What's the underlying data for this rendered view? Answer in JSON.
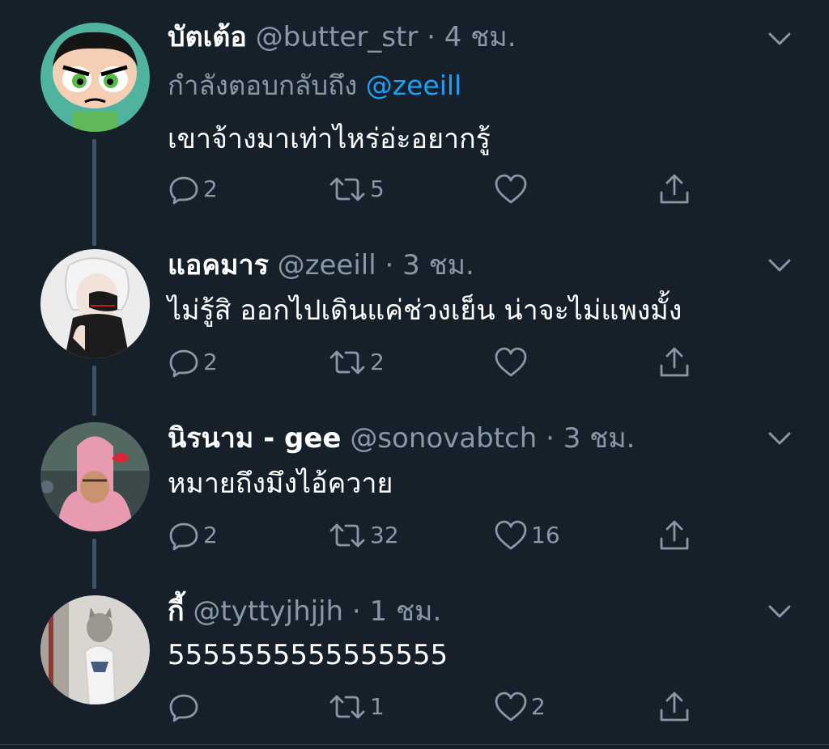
{
  "colors": {
    "background": "#15202b",
    "secondary_text": "#8899a6",
    "link": "#1da1f2",
    "thread_line": "#3d5466"
  },
  "tweets": [
    {
      "display_name": "บัตเต้อ",
      "handle": "@butter_str",
      "separator": "·",
      "time": "4 ชม.",
      "reply_prefix": "กำลังตอบกลับถึง",
      "reply_mention": "@zeeill",
      "text": "เขาจ้างมาเท่าไหร่อ่ะอยากรู้",
      "reply_count": "2",
      "retweet_count": "5",
      "like_count": "",
      "avatar_icon": "powerpuff-buttercup-avatar"
    },
    {
      "display_name": "แอคมาร",
      "handle": "@zeeill",
      "separator": "·",
      "time": "3 ชม.",
      "text": "ไม่รู้สิ ออกไปเดินแค่ช่วงเย็น น่าจะไม่แพงมั้ง",
      "reply_count": "2",
      "retweet_count": "2",
      "like_count": "",
      "avatar_icon": "anime-masked-character-avatar"
    },
    {
      "display_name": "นิรนาม - gee",
      "handle": "@sonovabtch",
      "separator": "·",
      "time": "3 ชม.",
      "text": "หมายถึงมึงไอ้ควาย",
      "reply_count": "2",
      "retweet_count": "32",
      "like_count": "16",
      "avatar_icon": "pink-costume-person-avatar"
    },
    {
      "display_name": "กี้",
      "handle": "@tyttyjhjjh",
      "separator": "·",
      "time": "1 ชม.",
      "text": "5555555555555555",
      "reply_count": "",
      "retweet_count": "1",
      "like_count": "2",
      "avatar_icon": "dressed-cat-avatar"
    }
  ]
}
